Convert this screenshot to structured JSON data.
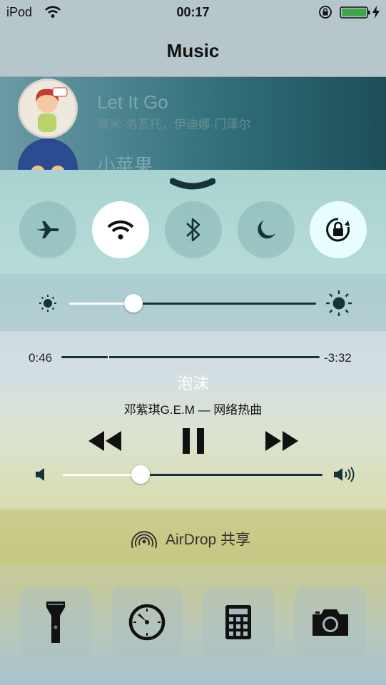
{
  "status_bar": {
    "carrier": "iPod",
    "time": "00:17",
    "icons": [
      "wifi-icon",
      "rotation-lock-icon",
      "battery-icon",
      "charging-bolt-icon"
    ]
  },
  "nav": {
    "title": "Music"
  },
  "song_list": [
    {
      "title": "Let It Go",
      "artist": "黛米·洛瓦托，伊迪娜·门泽尔"
    },
    {
      "title": "小苹果",
      "artist": ""
    }
  ],
  "control_center": {
    "toggles": [
      {
        "name": "airplane-mode",
        "icon": "airplane-icon",
        "on": false
      },
      {
        "name": "wifi",
        "icon": "wifi-icon",
        "on": true
      },
      {
        "name": "bluetooth",
        "icon": "bluetooth-icon",
        "on": false
      },
      {
        "name": "do-not-disturb",
        "icon": "moon-icon",
        "on": false
      },
      {
        "name": "rotation-lock",
        "icon": "rotation-lock-icon",
        "on": true
      }
    ],
    "brightness_level": 0.26,
    "now_playing": {
      "elapsed": "0:46",
      "remaining": "-3:32",
      "progress": 0.18,
      "title": "泡沫",
      "subtitle": "邓紫琪G.E.M — 网络热曲"
    },
    "volume_level": 0.3,
    "airdrop": {
      "label": "AirDrop 共享"
    },
    "shortcuts": [
      "flashlight-icon",
      "timer-icon",
      "calculator-icon",
      "camera-icon"
    ],
    "colors": {
      "toggle_on_white": "#ffffff",
      "toggle_on_cyan": "#e9ffff",
      "track_title": "#ffffff"
    }
  }
}
